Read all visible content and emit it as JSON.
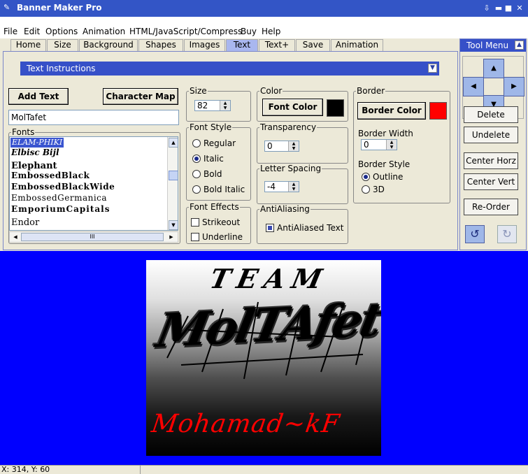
{
  "window": {
    "title": "Banner Maker Pro"
  },
  "menu": [
    "File",
    "Edit",
    "Options",
    "Animation",
    "HTML/JavaScript/Compress",
    "Buy",
    "Help"
  ],
  "menu_underline": [
    "F",
    "E",
    "O",
    "A",
    "H",
    "B",
    "H"
  ],
  "tabs": [
    "Home",
    "Size",
    "Background",
    "Shapes",
    "Images",
    "Text",
    "Text+",
    "Save",
    "Animation"
  ],
  "active_tab": "Text",
  "instructions": {
    "label": "Text Instructions"
  },
  "text": {
    "add_text": "Add Text",
    "character_map": "Character Map",
    "value": "MolTafet",
    "fonts_label": "Fonts",
    "fonts": [
      "ELAM-PHIKI",
      "Elbisc Bijl",
      "Elephant",
      "EmbossedBlack",
      "EmbossedBlackWide",
      "EmbossedGermanica",
      "EmporiumCapitals",
      "Endor"
    ],
    "selected_font_index": 0
  },
  "size": {
    "label": "Size",
    "value": "82"
  },
  "font_style": {
    "label": "Font Style",
    "options": [
      "Regular",
      "Italic",
      "Bold",
      "Bold Italic"
    ],
    "selected": "Italic"
  },
  "font_effects": {
    "label": "Font Effects",
    "options": [
      "Strikeout",
      "Underline"
    ]
  },
  "color": {
    "label": "Color",
    "button": "Font Color",
    "value": "#000000"
  },
  "transparency": {
    "label": "Transparency",
    "value": "0"
  },
  "letter_spacing": {
    "label": "Letter Spacing",
    "value": "-4"
  },
  "antialiasing": {
    "label": "AntiAliasing",
    "option": "AntiAliased Text",
    "checked": true
  },
  "border": {
    "label": "Border",
    "button": "Border Color",
    "color": "#ff0000",
    "width_label": "Border Width",
    "width": "0",
    "style_label": "Border Style",
    "styles": [
      "Outline",
      "3D"
    ],
    "selected_style": "Outline"
  },
  "tool_menu": {
    "title": "Tool Menu",
    "buttons": [
      "Delete",
      "Undelete",
      "Center Horz",
      "Center Vert",
      "Re-Order"
    ]
  },
  "banner": {
    "line1": "TEAM",
    "line2": "MolTAfet",
    "line3": "Mohamad~kF"
  },
  "status": {
    "coords": "X: 314, Y: 60"
  },
  "colors": {
    "titlebar": "#3355c6",
    "canvas_bg": "#0000ff",
    "active_tab": "#a9b7ef",
    "signature": "#ff0000"
  }
}
